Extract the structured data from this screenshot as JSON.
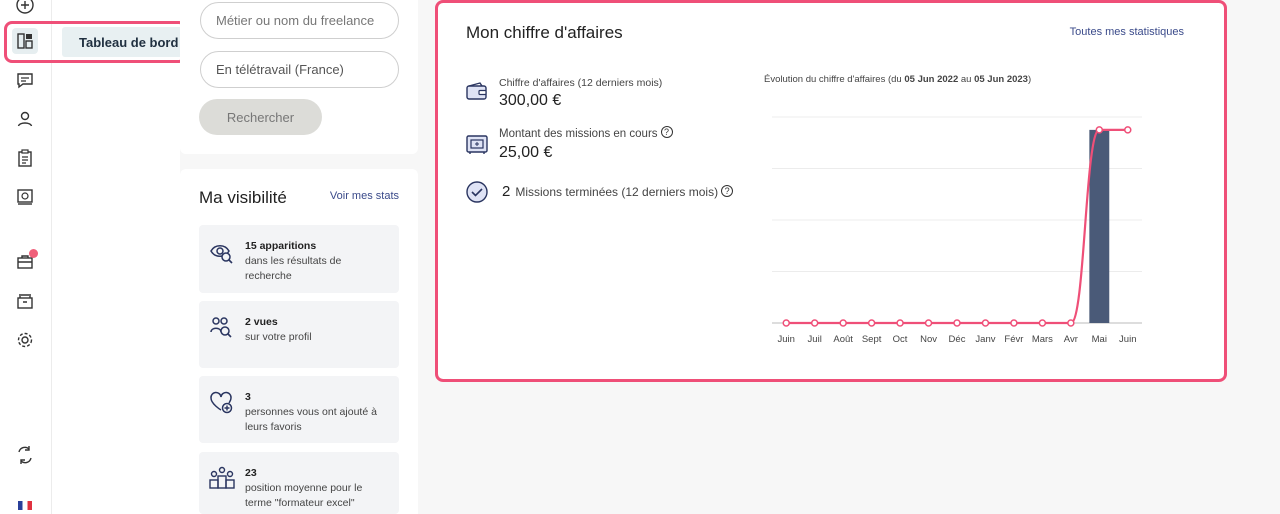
{
  "subnav": {
    "dashboard_label": "Tableau de bord"
  },
  "search": {
    "job_placeholder": "Métier ou nom du freelance",
    "location_value": "En télétravail (France)",
    "button_label": "Rechercher"
  },
  "visibility": {
    "title": "Ma visibilité",
    "link": "Voir mes stats",
    "items": [
      {
        "value": "15 apparitions",
        "text": "dans les résultats de recherche",
        "icon": "eye-search-icon"
      },
      {
        "value": "2 vues",
        "text": "sur votre profil",
        "icon": "people-search-icon"
      },
      {
        "value": "3",
        "text": "personnes vous ont ajouté à leurs favoris",
        "icon": "heart-plus-icon"
      },
      {
        "value": "23",
        "text": "position moyenne pour le terme \"formateur excel\"",
        "icon": "podium-icon"
      }
    ]
  },
  "revenue": {
    "title": "Mon chiffre d'affaires",
    "link": "Toutes mes statistiques",
    "revenue_label": "Chiffre d'affaires (12 derniers mois)",
    "revenue_value": "300,00 €",
    "missions_label": "Montant des missions en cours",
    "missions_value": "25,00 €",
    "completed_count": "2",
    "completed_label": "Missions terminées (12 derniers mois)",
    "chart_caption_prefix": "Évolution du chiffre d'affaires (du ",
    "chart_caption_start": "05 Jun 2022",
    "chart_caption_mid": " au ",
    "chart_caption_end": "05 Jun 2023",
    "chart_caption_suffix": ")"
  },
  "colors": {
    "accent": "#ef4f78",
    "bar": "#4a5a78",
    "line": "#ef4f78",
    "link": "#3a4a8a"
  },
  "chart_data": {
    "type": "bar",
    "categories": [
      "Juin",
      "Juil",
      "Août",
      "Sept",
      "Oct",
      "Nov",
      "Déc",
      "Janv",
      "Févr",
      "Mars",
      "Avr",
      "Mai",
      "Juin"
    ],
    "series": [
      {
        "type": "bar",
        "values": [
          0,
          0,
          0,
          0,
          0,
          0,
          0,
          0,
          0,
          0,
          0,
          300,
          0
        ]
      },
      {
        "type": "line",
        "values": [
          0,
          0,
          0,
          0,
          0,
          0,
          0,
          0,
          0,
          0,
          0,
          300,
          300
        ]
      }
    ],
    "ylim": [
      0,
      320
    ],
    "grid": true
  }
}
